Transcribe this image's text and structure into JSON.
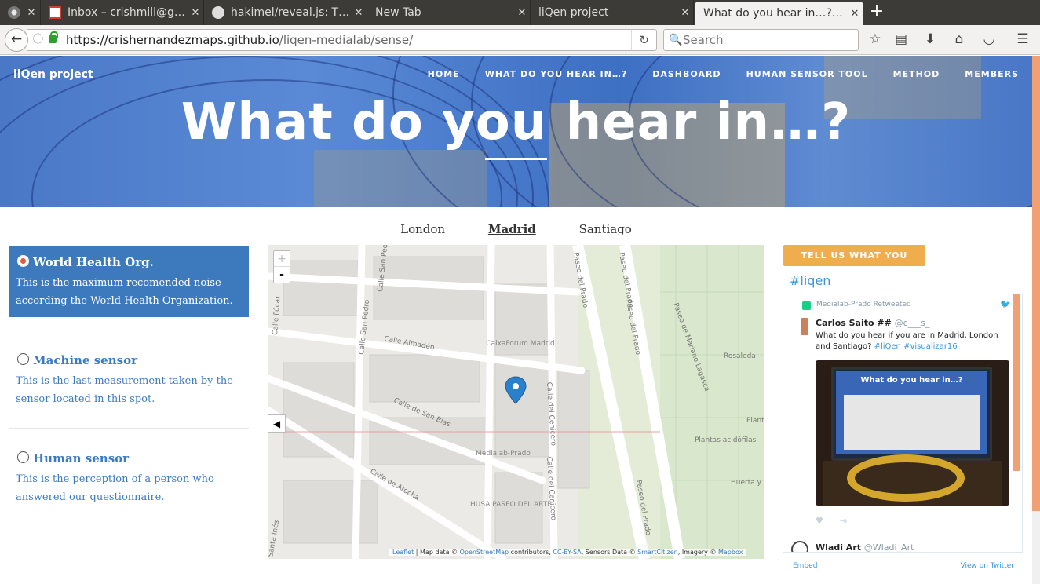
{
  "browser": {
    "tabs": [
      {
        "label": "",
        "icon": "firefox-icon"
      },
      {
        "label": "Inbox – crishmill@g…",
        "icon": "gmail-icon"
      },
      {
        "label": "hakimel/reveal.js: T…",
        "icon": "github-icon"
      },
      {
        "label": "New Tab",
        "icon": ""
      },
      {
        "label": "liQen project",
        "icon": ""
      },
      {
        "label": "What do you hear in…?…",
        "icon": ""
      }
    ],
    "url_host": "https://crishernandezmaps.github.io",
    "url_path": "/liqen-medialab/sense/",
    "search_placeholder": "Search"
  },
  "site": {
    "brand": "liQen project",
    "menu": [
      "HOME",
      "WHAT DO YOU HEAR IN…?",
      "DASHBOARD",
      "HUMAN SENSOR TOOL",
      "METHOD",
      "MEMBERS"
    ],
    "hero_title": "What do you hear in…?"
  },
  "cities": [
    "London",
    "Madrid",
    "Santiago"
  ],
  "selected_city": "Madrid",
  "sources": [
    {
      "title": "World Health Org.",
      "desc": "This is the maximum recomended noise according the World Health Organization.",
      "selected": true
    },
    {
      "title": "Machine sensor",
      "desc": "This is the last measurement taken by the sensor located in this spot.",
      "selected": false
    },
    {
      "title": "Human sensor",
      "desc": "This is the perception of a person who answered our questionnaire.",
      "selected": false
    }
  ],
  "map": {
    "zoom_in": "+",
    "zoom_out": "-",
    "streets": [
      "Calle San Pedro",
      "Calle San Pedro",
      "Calle Fúcar",
      "Calle Almadén",
      "Calle de San Blas",
      "Calle de Atocha",
      "Calle del Cenicero",
      "Calle del Cenicero",
      "Paseo del Prado",
      "Paseo del Prado",
      "Paseo del Prado",
      "Paseo del Prado",
      "Paseo de Mariano Lagasca",
      "Santa Inés"
    ],
    "places": [
      "CaixaForum Madrid",
      "Medialab-Prado",
      "HUSA PASEO DEL ARTE",
      "Rosaleda",
      "Plantas acidófilas",
      "Huerta y",
      "Plant"
    ],
    "attribution": {
      "leaflet": "Leaflet",
      "t1": " | Map data © ",
      "osm": "OpenStreetMap",
      "t2": " contributors, ",
      "cc": "CC-BY-SA",
      "t3": ", Sensors Data © ",
      "sc": "SmartCitizen",
      "t4": ", Imagery © ",
      "mb": "Mapbox"
    }
  },
  "feedback_button": "TELL US WHAT YOU THINK",
  "twitter": {
    "hashtag": "#liqen",
    "retweeted_by": "Medialab-Prado Retweeted",
    "author": "Carlos Saito ##",
    "handle": "@c___s_",
    "text_before": "What do you hear if you are in Madrid, London and Santiago? ",
    "tag1": "#liQen",
    "tag2": "#visualizar16",
    "photo_caption": "What do you hear in…?",
    "author2": "Wladi Art",
    "handle2": "@Wladi_Art",
    "embed": "Embed",
    "view": "View on Twitter"
  },
  "colors": {
    "accent": "#3d7abd",
    "button": "#f0ad4e",
    "scroll": "#f0a073",
    "link": "#3b94d9"
  }
}
